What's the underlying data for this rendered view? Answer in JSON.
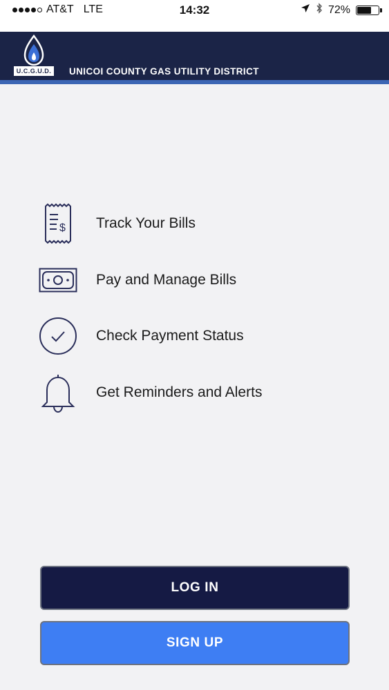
{
  "status_bar": {
    "carrier": "AT&T",
    "network": "LTE",
    "time": "14:32",
    "battery": "72%",
    "battery_level": 0.72,
    "signal_bars_filled": 4,
    "icons": [
      "location-arrow-icon",
      "bluetooth-icon",
      "battery-icon"
    ]
  },
  "header": {
    "logo_text": "U.C.G.U.D.",
    "title": "UNICOI COUNTY GAS UTILITY DISTRICT",
    "colors": {
      "background": "#1b2447",
      "accent": "#3c66b4"
    }
  },
  "features": [
    {
      "icon": "receipt-icon",
      "label": "Track Your Bills"
    },
    {
      "icon": "money-icon",
      "label": "Pay and Manage Bills"
    },
    {
      "icon": "check-circle-icon",
      "label": "Check Payment Status"
    },
    {
      "icon": "bell-icon",
      "label": "Get Reminders and Alerts"
    }
  ],
  "buttons": {
    "login_label": "LOG IN",
    "signup_label": "SIGN UP",
    "colors": {
      "login": "#151a44",
      "signup": "#3e7ef3"
    }
  }
}
